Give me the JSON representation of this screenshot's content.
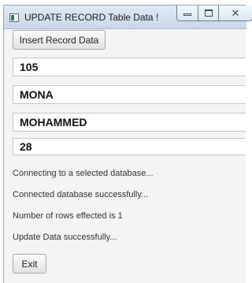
{
  "window": {
    "title": "UPDATE RECORD Table Data !",
    "minimize_glyph": "",
    "maximize_glyph": "",
    "close_glyph": "✕"
  },
  "toolbar": {
    "insert_label": "Insert Record Data"
  },
  "fields": {
    "id_value": "105",
    "first_name_value": "MONA",
    "last_name_value": "MOHAMMED",
    "age_value": "28"
  },
  "status_lines": [
    "Connecting to a selected database...",
    "Connected database successfully...",
    "Number of rows effected is 1",
    "Update Data successfully..."
  ],
  "footer": {
    "exit_label": "Exit"
  }
}
